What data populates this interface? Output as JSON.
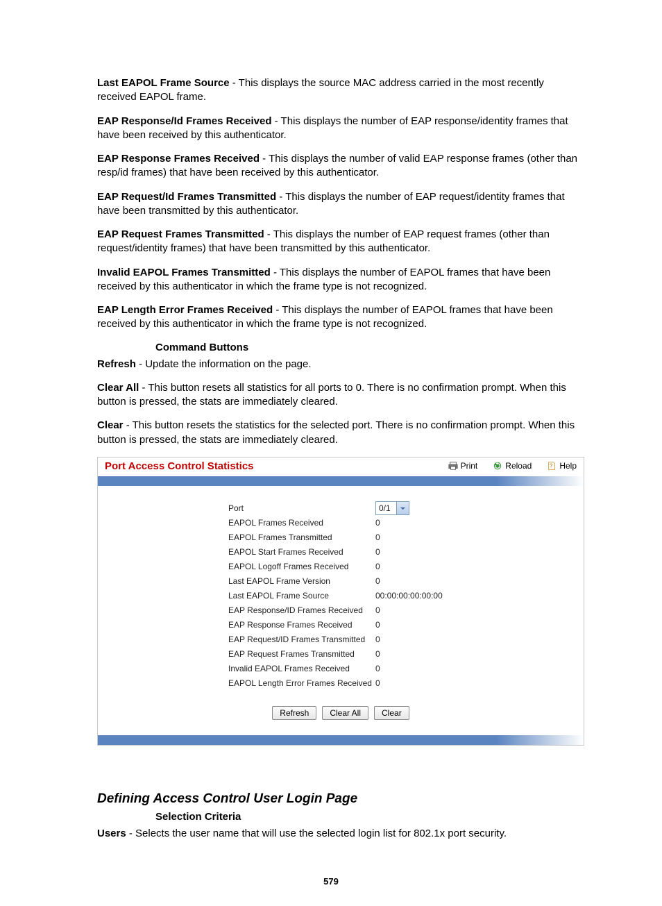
{
  "defs": [
    {
      "term": "Last EAPOL Frame Source",
      "text": " - This displays the source MAC address carried in the most recently received EAPOL frame."
    },
    {
      "term": "EAP Response/Id Frames Received",
      "text": " - This displays the number of EAP response/identity frames that have been received by this authenticator."
    },
    {
      "term": "EAP Response Frames Received",
      "text": " - This displays the number of valid EAP response frames (other than resp/id frames) that have been received by this authenticator."
    },
    {
      "term": "EAP Request/Id Frames Transmitted",
      "text": " - This displays the number of EAP request/identity frames that have been transmitted by this authenticator."
    },
    {
      "term": "EAP Request Frames Transmitted",
      "text": " - This displays the number of EAP request frames (other than request/identity frames) that have been transmitted by this authenticator."
    },
    {
      "term": "Invalid EAPOL Frames Transmitted",
      "text": " - This displays the number of EAPOL frames that have been received by this authenticator in which the frame type is not recognized."
    },
    {
      "term": "EAP Length Error Frames Received",
      "text": " - This displays the number of EAPOL frames that have been received by this authenticator in which the frame type is not recognized."
    }
  ],
  "cmd_heading": "Command Buttons",
  "cmds": [
    {
      "term": "Refresh",
      "text": " - Update the information on the page."
    },
    {
      "term": "Clear All",
      "text": " - This button resets all statistics for all ports to 0. There is no confirmation prompt. When this button is pressed, the stats are immediately cleared."
    },
    {
      "term": "Clear",
      "text": " - This button resets the statistics for the selected port. There is no confirmation prompt. When this button is pressed, the stats are immediately cleared."
    }
  ],
  "panel": {
    "title": "Port Access Control Statistics",
    "actions": {
      "print": "Print",
      "reload": "Reload",
      "help": "Help"
    },
    "port_label": "Port",
    "port_value": "0/1",
    "rows": [
      {
        "label": "EAPOL Frames Received",
        "value": "0"
      },
      {
        "label": "EAPOL Frames Transmitted",
        "value": "0"
      },
      {
        "label": "EAPOL Start Frames Received",
        "value": "0"
      },
      {
        "label": "EAPOL Logoff Frames Received",
        "value": "0"
      },
      {
        "label": "Last EAPOL Frame Version",
        "value": "0"
      },
      {
        "label": "Last EAPOL Frame Source",
        "value": "00:00:00:00:00:00"
      },
      {
        "label": "EAP Response/ID Frames Received",
        "value": "0"
      },
      {
        "label": "EAP Response Frames Received",
        "value": "0"
      },
      {
        "label": "EAP Request/ID Frames Transmitted",
        "value": "0"
      },
      {
        "label": "EAP Request Frames Transmitted",
        "value": "0"
      },
      {
        "label": "Invalid EAPOL Frames Received",
        "value": "0"
      },
      {
        "label": "EAPOL Length Error Frames Received",
        "value": "0"
      }
    ],
    "buttons": {
      "refresh": "Refresh",
      "clear_all": "Clear All",
      "clear": "Clear"
    }
  },
  "section2": {
    "title": "Defining Access Control User Login Page",
    "sub": "Selection Criteria",
    "users_term": "Users",
    "users_text": " - Selects the user name that will use the selected login list for 802.1x port security."
  },
  "page_number": "579"
}
